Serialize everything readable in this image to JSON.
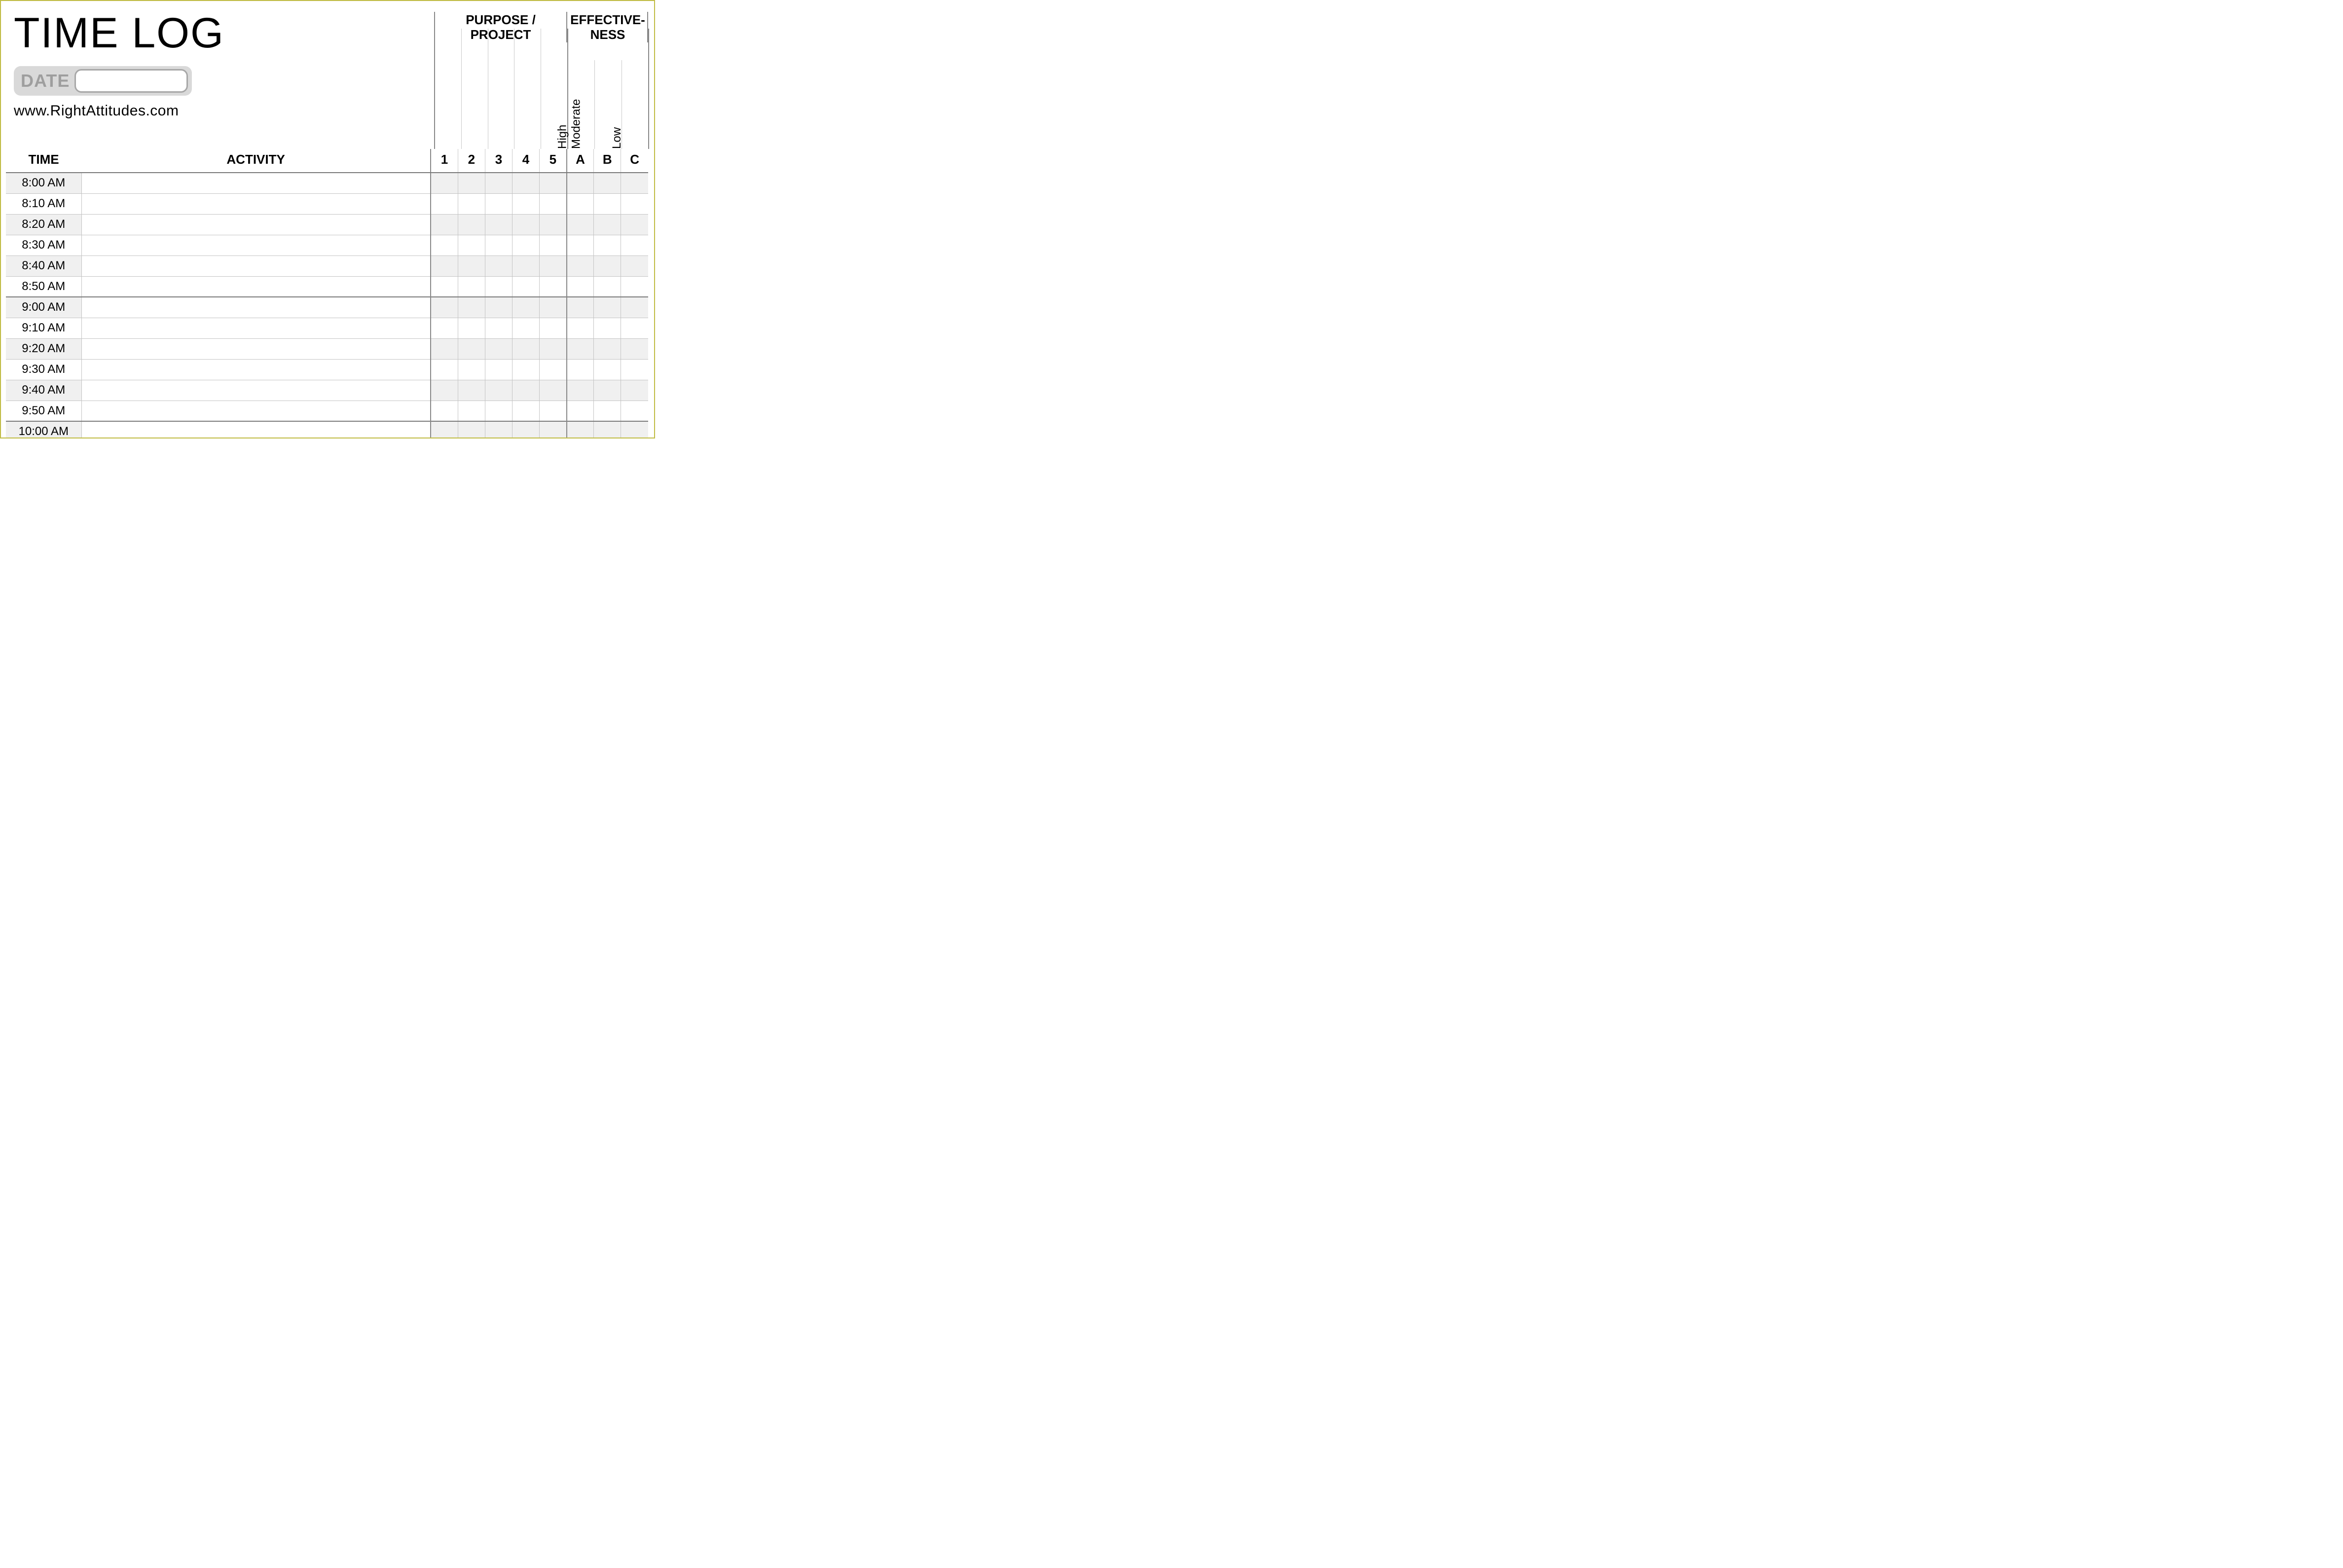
{
  "title": "TIME LOG",
  "date_label": "DATE",
  "date_value": "",
  "url": "www.RightAttitudes.com",
  "group_headers": {
    "purpose": "PURPOSE / PROJECT",
    "effectiveness": "EFFECTIVE-\nNESS"
  },
  "columns": {
    "time": "TIME",
    "activity": "ACTIVITY",
    "purpose_nums": [
      "1",
      "2",
      "3",
      "4",
      "5"
    ],
    "effectiveness_letters": [
      "A",
      "B",
      "C"
    ],
    "effectiveness_labels": [
      "High",
      "Moderate",
      "Low"
    ]
  },
  "rows": [
    {
      "time": "8:00 AM",
      "hour_start": true,
      "alt": true
    },
    {
      "time": "8:10 AM",
      "alt": false
    },
    {
      "time": "8:20 AM",
      "alt": true
    },
    {
      "time": "8:30 AM",
      "alt": false
    },
    {
      "time": "8:40 AM",
      "alt": true
    },
    {
      "time": "8:50 AM",
      "alt": false
    },
    {
      "time": "9:00 AM",
      "hour_start": true,
      "alt": true
    },
    {
      "time": "9:10 AM",
      "alt": false
    },
    {
      "time": "9:20 AM",
      "alt": true
    },
    {
      "time": "9:30 AM",
      "alt": false
    },
    {
      "time": "9:40 AM",
      "alt": true
    },
    {
      "time": "9:50 AM",
      "alt": false
    },
    {
      "time": "10:00 AM",
      "hour_start": true,
      "alt": true
    }
  ]
}
